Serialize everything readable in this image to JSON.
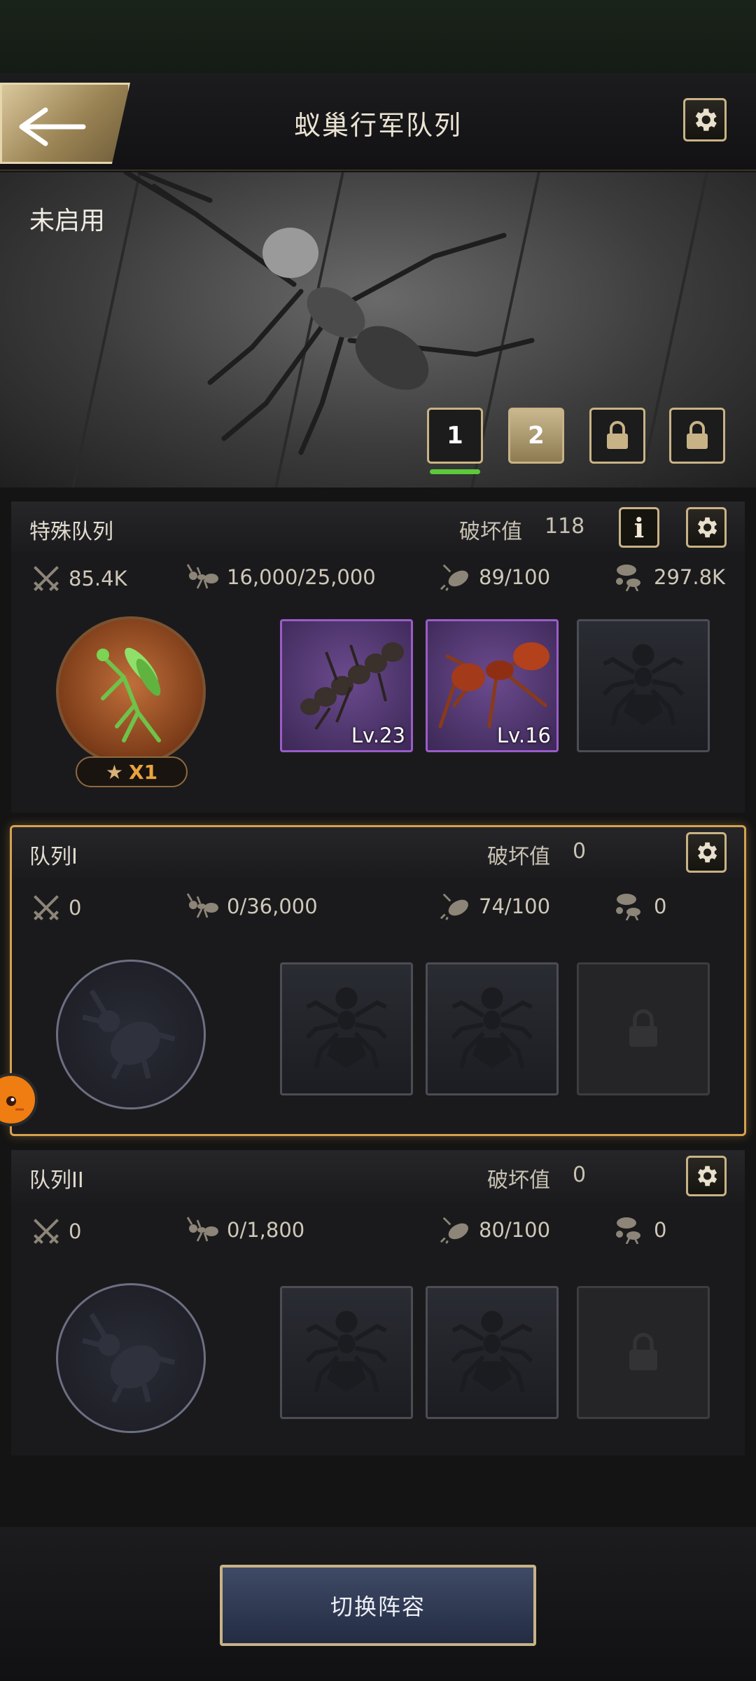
{
  "header": {
    "title": "蚁巢行军队列"
  },
  "hero": {
    "status": "未启用",
    "tabs": [
      "1",
      "2"
    ],
    "locked_tabs": 2,
    "active_tab": 1
  },
  "special_squad": {
    "name": "特殊队列",
    "score_label": "破坏值",
    "score": "118",
    "info_label": "i",
    "stats": {
      "power": "85.4K",
      "troops": "16,000/25,000",
      "capacity": "89/100",
      "load": "297.8K"
    },
    "leader_stars": "X1",
    "slots": [
      {
        "level": "Lv.23"
      },
      {
        "level": "Lv.16"
      }
    ]
  },
  "squad_1": {
    "name": "队列I",
    "score_label": "破坏值",
    "score": "0",
    "stats": {
      "power": "0",
      "troops": "0/36,000",
      "capacity": "74/100",
      "load": "0"
    }
  },
  "squad_2": {
    "name": "队列II",
    "score_label": "破坏值",
    "score": "0",
    "stats": {
      "power": "0",
      "troops": "0/1,800",
      "capacity": "80/100",
      "load": "0"
    }
  },
  "footer": {
    "switch_label": "切换阵容"
  },
  "colors": {
    "accent": "#c8b386",
    "selected": "#d6a24f",
    "active_tab": "#5cc93a",
    "rare": "#9a5cc9"
  }
}
